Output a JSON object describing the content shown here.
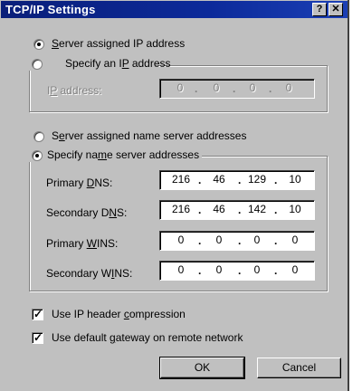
{
  "window": {
    "title": "TCP/IP Settings",
    "help_glyph": "?",
    "close_glyph": "✕"
  },
  "ip": {
    "server_assigned": {
      "pre": "",
      "u": "S",
      "post": "erver assigned IP address"
    },
    "specify": {
      "pre": "Specify an I",
      "u": "P",
      "post": " address"
    },
    "address_label": {
      "pre": "I",
      "u": "P",
      "post": " address:"
    },
    "octets": [
      "0",
      "0",
      "0",
      "0"
    ],
    "selected": "server_assigned"
  },
  "dns": {
    "server_assigned": {
      "pre": "S",
      "u": "e",
      "post": "rver assigned name server addresses"
    },
    "specify": {
      "pre": "Specify na",
      "u": "m",
      "post": "e server addresses"
    },
    "selected": "specify",
    "fields": [
      {
        "label_pre": "Primary ",
        "label_u": "D",
        "label_post": "NS:",
        "octets": [
          "216",
          "46",
          "129",
          "10"
        ]
      },
      {
        "label_pre": "Secondary D",
        "label_u": "N",
        "label_post": "S:",
        "octets": [
          "216",
          "46",
          "142",
          "10"
        ]
      },
      {
        "label_pre": "Primary ",
        "label_u": "W",
        "label_post": "INS:",
        "octets": [
          "0",
          "0",
          "0",
          "0"
        ]
      },
      {
        "label_pre": "Secondary W",
        "label_u": "I",
        "label_post": "NS:",
        "octets": [
          "0",
          "0",
          "0",
          "0"
        ]
      }
    ]
  },
  "options": {
    "header_compression": {
      "pre": "Use IP header ",
      "u": "c",
      "post": "ompression",
      "checked": true
    },
    "default_gateway": {
      "pre": "Use default ",
      "u": "g",
      "post": "ateway on remote network",
      "checked": true
    }
  },
  "buttons": {
    "ok": "OK",
    "cancel": "Cancel"
  },
  "colors": {
    "face": "#c0c0c0",
    "titlebar": "#0a1f7a"
  }
}
